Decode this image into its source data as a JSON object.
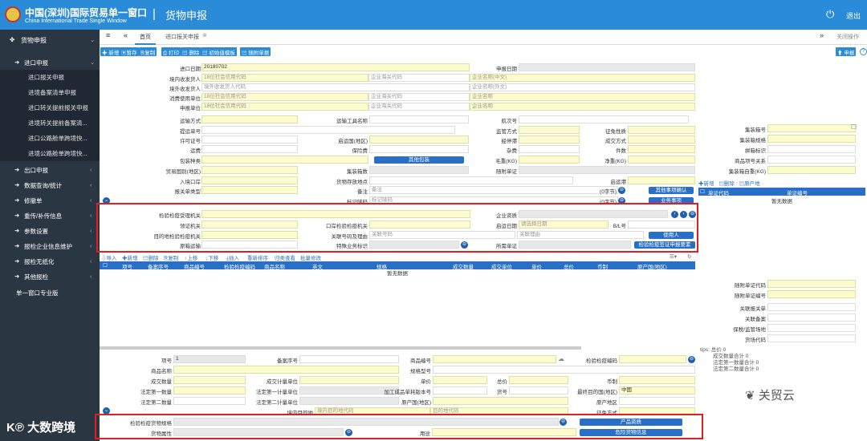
{
  "header": {
    "title_cn": "中国(深圳)国际贸易单一窗口",
    "title_en": "China International Trade Single Window",
    "separator": "|",
    "app_title": "货物申报",
    "logout": "退出"
  },
  "sidebar": {
    "root": "货物申报",
    "import_group": "进口申报",
    "import_items": [
      "进口报关申报",
      "进境备案清单申报",
      "进口转关提前报关申报",
      "进境转关提前备案清...",
      "进口公路舱单跨境快...",
      "进境公路舱单跨境快..."
    ],
    "groups": [
      "出口申报",
      "数据查询/统计",
      "修撤单",
      "重传/补传信息",
      "参数设置",
      "报检企业信息维护",
      "报检无纸化",
      "其他报检"
    ],
    "footer": "单一窗口专业版"
  },
  "tabs": {
    "home": "首页",
    "active": "进口报关申报",
    "close_ops": "关闭操作"
  },
  "toolbar": {
    "buttons": [
      "新增",
      "暂存",
      "复制",
      "打印",
      "删除",
      "初始值模板",
      "随附单据"
    ],
    "declare": "申报"
  },
  "form": {
    "import_date_label": "进口日期",
    "import_date": "20180702",
    "apply_date_label": "申报日期",
    "consignee_label": "境内收发货人",
    "consignee_ph": "18位社会信用代码",
    "foreign_label": "境外收发货人",
    "foreign_ph": "境外收发货人代码",
    "consumer_label": "消费使用单位",
    "consumer_ph": "18位社会信用代码",
    "declarer_label": "申报单位",
    "declarer_ph": "18位社会信用代码",
    "customs_code": "企业海关代码",
    "name_cn": "企业名称(中文)",
    "name_en": "企业名称(外文)",
    "name": "企业名称",
    "transport_mode": "运输方式",
    "transport_name": "运输工具名称",
    "voyage": "航次号",
    "bill_no": "提运单号",
    "supervision": "监管方式",
    "tax_nature": "征免性质",
    "license": "许可证号",
    "origin_country": "启运国(地区)",
    "stopover": "经停港",
    "deal_mode": "成交方式",
    "freight": "运费",
    "insurance": "保险费",
    "misc": "杂费",
    "pieces": "件数",
    "pack_type": "包装种类",
    "other_pack": "其他包装",
    "gross": "毛重(KG)",
    "net": "净重(KG)",
    "trade_country": "贸易国别(地区)",
    "container_count": "集装箱数",
    "attach": "随附单证",
    "entry_port": "入境口岸",
    "goods_location": "货物存放地点",
    "dep_port": "启运港",
    "declare_type": "报关单类型",
    "remark": "备注",
    "remark_ph": "备注",
    "other_confirm": "其他事项确认",
    "mark": "标记唛码",
    "mark_ph": "标记唛码",
    "business_item": "业务事项",
    "char_count": "(0字节)"
  },
  "inspection": {
    "org_label": "检验检疫受理机关",
    "qualification": "企业资质",
    "cert_org": "领证机关",
    "port_org": "口岸检验检疫机关",
    "start_date": "启运日期",
    "start_date_ph": "请选择日期",
    "bl": "B/L号",
    "dest_org": "目的地检验检疫机关",
    "link_no": "关联号码及理由",
    "link_no_ph": "关联号码",
    "link_reason_ph": "关联理由",
    "user": "使用人",
    "original_box": "原箱运输",
    "special": "特殊业务标识",
    "required_cert": "所需单证",
    "cert_apply": "检验检疫签证申报要素"
  },
  "goods_toolbar": [
    "导入",
    "新增",
    "删除",
    "复制",
    "上移",
    "下移",
    "插入",
    "重新排序",
    "归类查看",
    "批量修改"
  ],
  "goods_headers": [
    "项号",
    "备案序号",
    "商品编号",
    "检验检疫编码",
    "商品名称",
    "英文",
    "规格",
    "成交数量",
    "成交单位",
    "单价",
    "总价",
    "币制",
    "原产国(地区)"
  ],
  "no_data": "暂无数据",
  "detail": {
    "item_no": "项号",
    "item_val": "1",
    "record_no": "备案序号",
    "goods_no": "商品编号",
    "ciq_code": "检验检疫编码",
    "goods_name": "商品名称",
    "spec": "规格型号",
    "deal_qty": "成交数量",
    "deal_unit": "成交计量单位",
    "unit_price": "单价",
    "total": "总价",
    "currency": "币制",
    "legal_qty1": "法定第一数量",
    "legal_unit1": "法定第一计量单位",
    "processed_ver": "加工成品单耗版本号",
    "goods_seq": "货号",
    "dest_country": "最终目的国(地区)",
    "dest_val": "中国",
    "legal_qty2": "法定第二数量",
    "legal_unit2": "法定第二计量单位",
    "origin": "原产国(地区)",
    "origin_region": "原产地区",
    "dest_place": "境内目的地",
    "dest_place_ph": "境内目的地代码",
    "dest_place_name_ph": "目的地代码",
    "tax_mode": "征免方式",
    "ciq_spec": "检验检疫货物规格",
    "goods_attr": "货物属性",
    "usage": "用途",
    "product_qual": "产品资质",
    "danger_info": "危险货物信息"
  },
  "right_panel": {
    "container_no": "集装箱号",
    "container_spec": "集装箱规格",
    "spell": "拼箱标识",
    "item_rel": "商品项号关系",
    "container_weight": "集装箱自重(KG)",
    "doc_actions": [
      "新增",
      "删除",
      "原产地"
    ],
    "doc_headers": [
      "单证代码",
      "单证编号"
    ],
    "attach_doc_code": "随附单证代码",
    "attach_doc_no": "随附单证编号",
    "rel_decl": "关联报关单",
    "rel_record": "关联备案",
    "bonded": "保税/监管场地",
    "yard": "货场代码",
    "tips": "tips: 总价 0",
    "tip_lines": [
      "成交数量合计 0",
      "法定第一数量合计 0",
      "法定第二数量合计 0"
    ]
  },
  "watermarks": {
    "left": "大数跨境",
    "right": "关贸云"
  }
}
